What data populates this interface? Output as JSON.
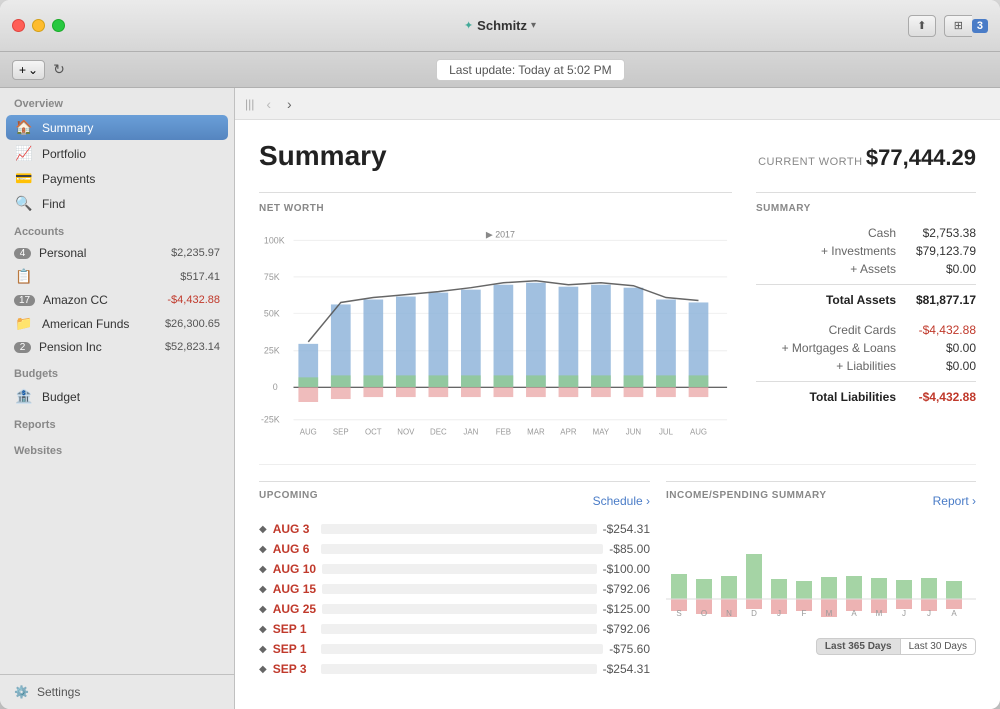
{
  "window": {
    "title": "Schmitz",
    "last_update": "Last update:  Today at 5:02 PM"
  },
  "toolbar": {
    "add_label": "+",
    "add_arrow": "⌄"
  },
  "sidebar": {
    "overview_label": "Overview",
    "summary_label": "Summary",
    "portfolio_label": "Portfolio",
    "payments_label": "Payments",
    "find_label": "Find",
    "accounts_label": "Accounts",
    "personal_label": "Personal",
    "personal_badge": "4",
    "personal_value": "$2,235.97",
    "account2_value": "$517.41",
    "amazon_label": "Amazon CC",
    "amazon_badge": "17",
    "amazon_value": "-$4,432.88",
    "american_funds_label": "American Funds",
    "american_funds_value": "$26,300.65",
    "pension_label": "Pension Inc",
    "pension_badge": "2",
    "pension_value": "$52,823.14",
    "budgets_label": "Budgets",
    "budget_label": "Budget",
    "reports_label": "Reports",
    "websites_label": "Websites",
    "settings_label": "Settings"
  },
  "summary": {
    "title": "Summary",
    "current_worth_label": "CURRENT WORTH",
    "current_worth_value": "$77,444.29"
  },
  "net_worth": {
    "label": "NET WORTH",
    "year_label": "2017",
    "x_labels": [
      "AUG",
      "SEP",
      "OCT",
      "NOV",
      "DEC",
      "JAN",
      "FEB",
      "MAR",
      "APR",
      "MAY",
      "JUN",
      "JUL",
      "AUG"
    ],
    "y_labels": [
      "100K",
      "75K",
      "50K",
      "25K",
      "0",
      "-25K"
    ]
  },
  "summary_table": {
    "label": "SUMMARY",
    "cash_label": "Cash",
    "cash_value": "$2,753.38",
    "investments_label": "+ Investments",
    "investments_value": "$79,123.79",
    "assets_label": "+ Assets",
    "assets_value": "$0.00",
    "total_assets_label": "Total Assets",
    "total_assets_value": "$81,877.17",
    "credit_cards_label": "Credit Cards",
    "credit_cards_value": "-$4,432.88",
    "mortgages_label": "+ Mortgages & Loans",
    "mortgages_value": "$0.00",
    "liabilities_label": "+ Liabilities",
    "liabilities_value": "$0.00",
    "total_liabilities_label": "Total Liabilities",
    "total_liabilities_value": "-$4,432.88"
  },
  "upcoming": {
    "label": "UPCOMING",
    "schedule_link": "Schedule ›",
    "rows": [
      {
        "date": "AUG 3",
        "amount": "-$254.31"
      },
      {
        "date": "AUG 6",
        "amount": "-$85.00"
      },
      {
        "date": "AUG 10",
        "amount": "-$100.00"
      },
      {
        "date": "AUG 15",
        "amount": "-$792.06"
      },
      {
        "date": "AUG 25",
        "amount": "-$125.00"
      },
      {
        "date": "SEP 1",
        "amount": "-$792.06"
      },
      {
        "date": "SEP 1",
        "amount": "-$75.60"
      },
      {
        "date": "SEP 3",
        "amount": "-$254.31"
      }
    ]
  },
  "income_spending": {
    "label": "INCOME/SPENDING SUMMARY",
    "report_link": "Report ›",
    "x_labels": [
      "S",
      "O",
      "N",
      "D",
      "J",
      "F",
      "M",
      "A",
      "M",
      "J",
      "J",
      "A"
    ],
    "period_btn1": "Last 365 Days",
    "period_btn2": "Last 30 Days"
  }
}
